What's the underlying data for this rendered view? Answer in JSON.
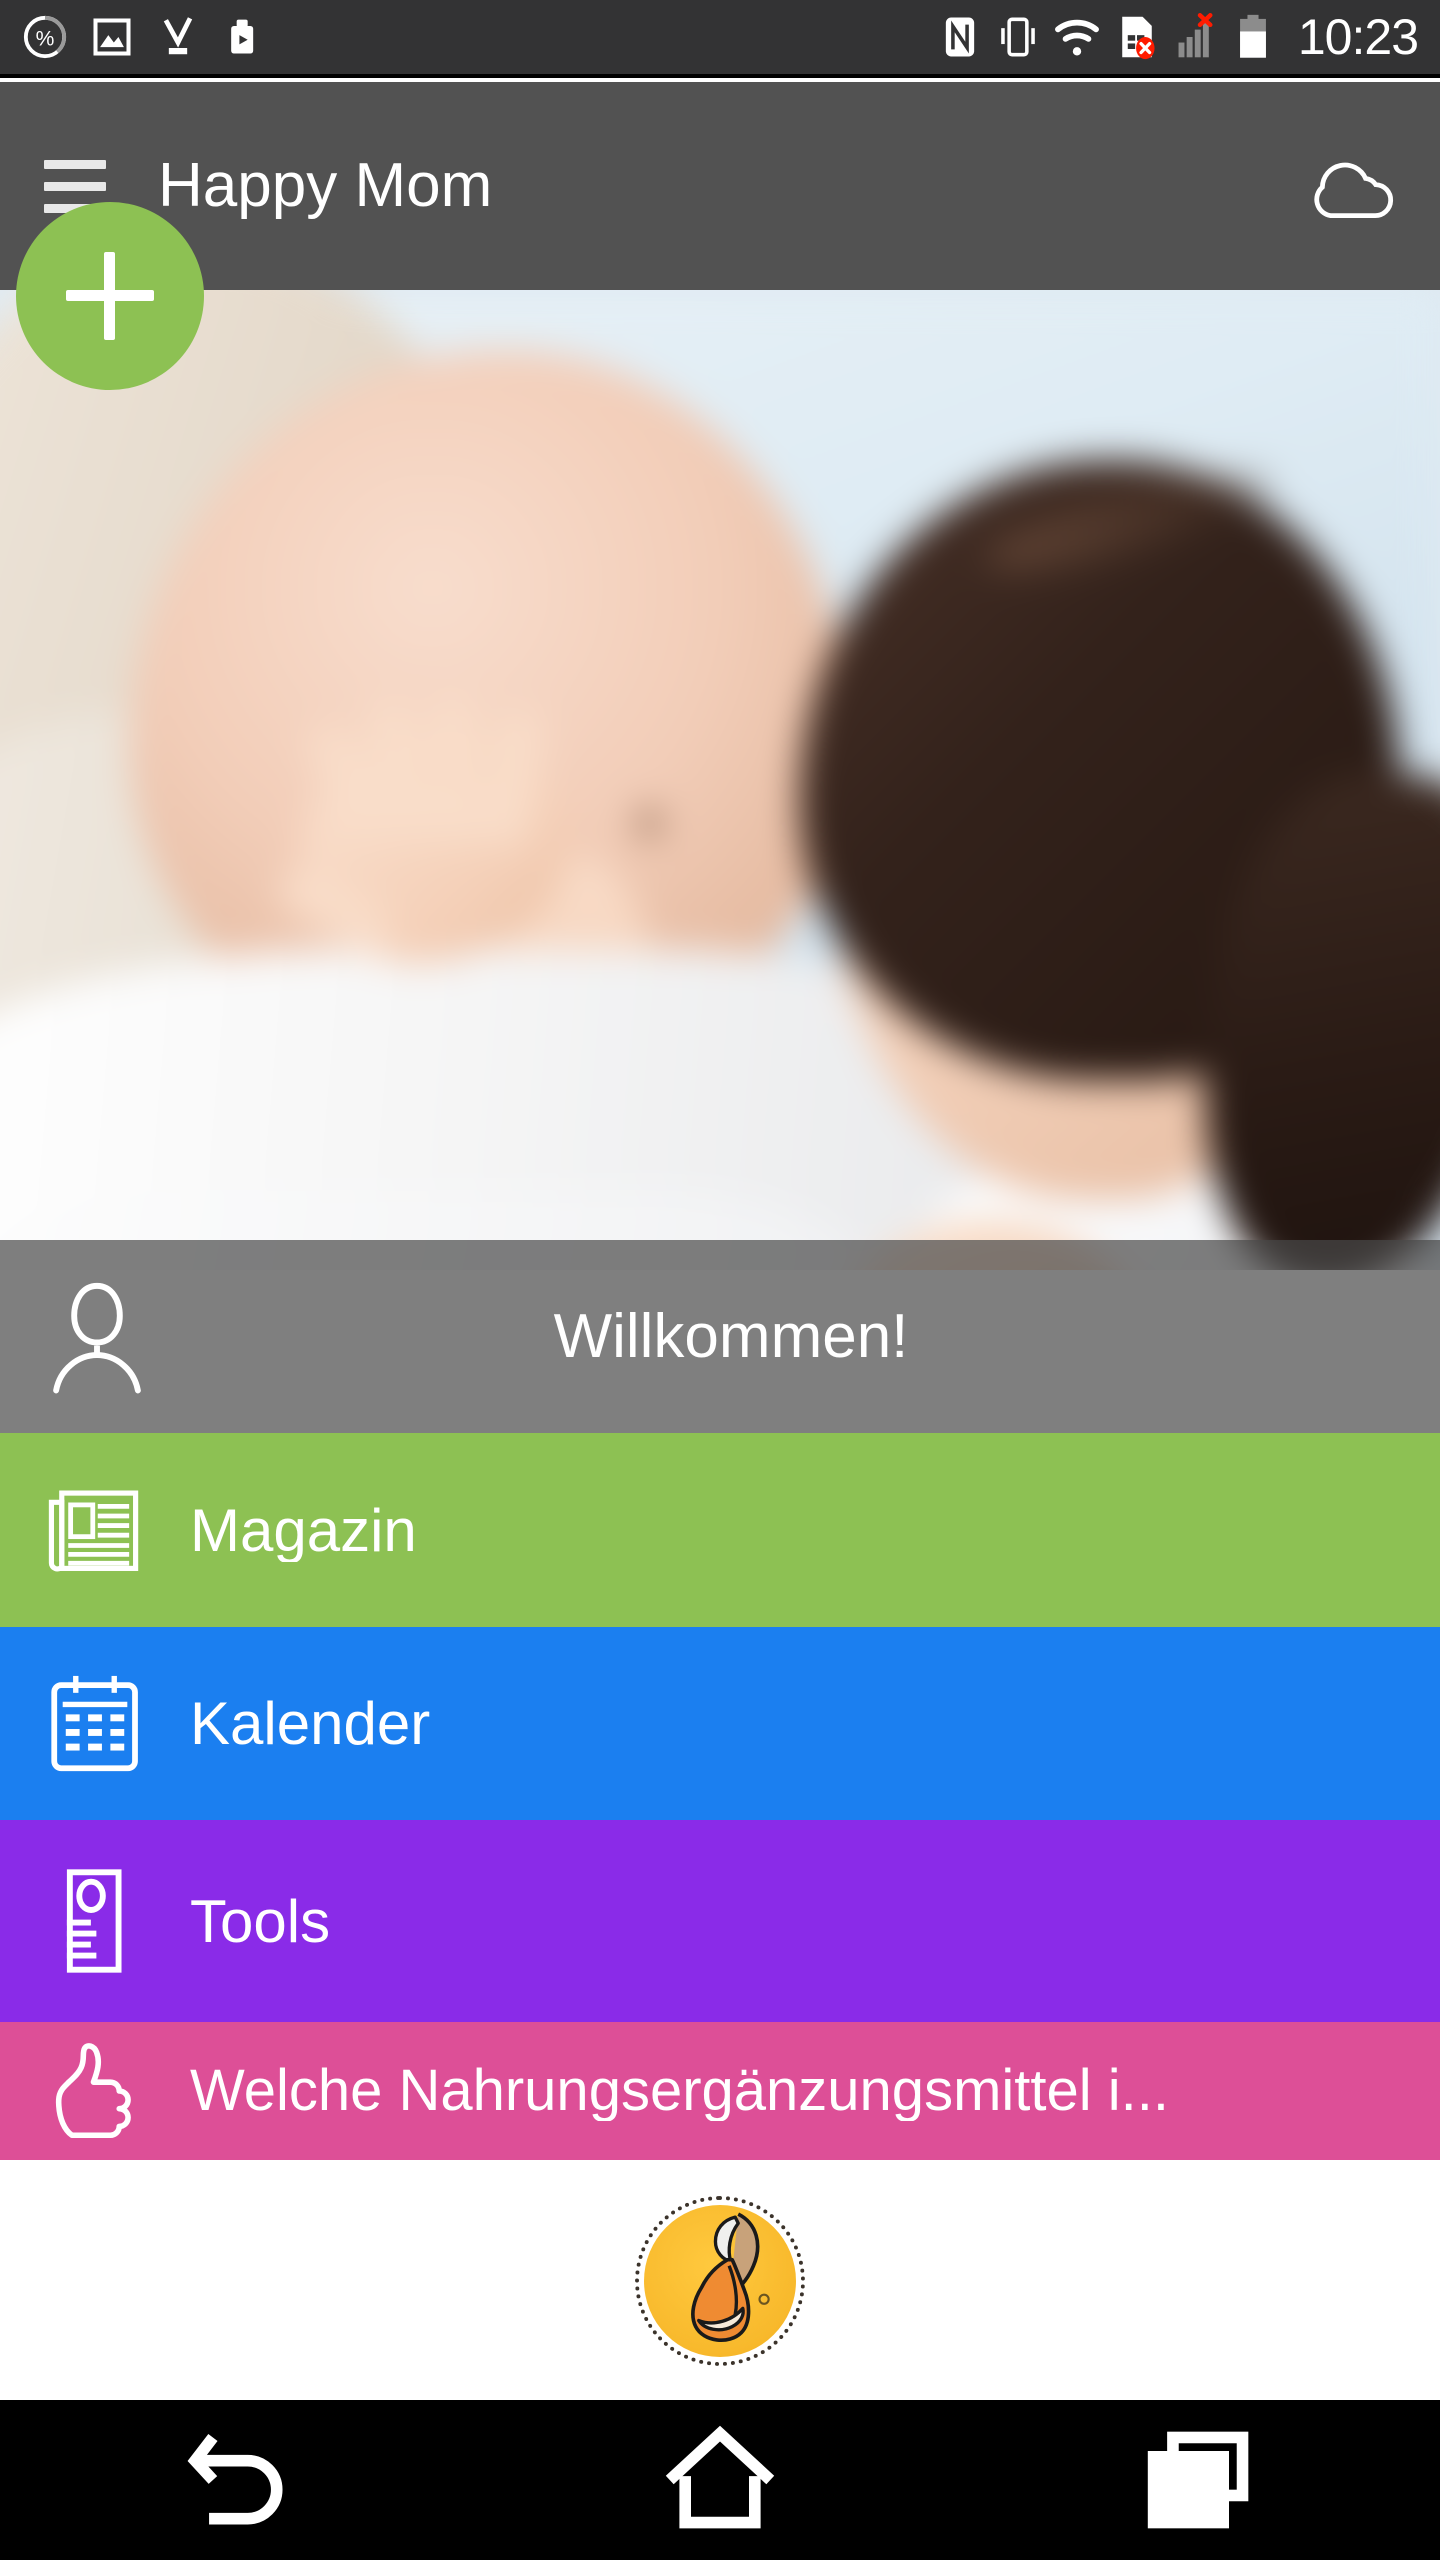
{
  "status_bar": {
    "time": "10:23",
    "left_icons": [
      {
        "name": "battery-percent-icon",
        "label": "%"
      },
      {
        "name": "gallery-image-icon",
        "label": "image"
      },
      {
        "name": "download-complete-icon",
        "label": "download"
      },
      {
        "name": "app-install-icon",
        "label": "app"
      }
    ],
    "right_icons": [
      {
        "name": "nfc-icon",
        "label": "NFC"
      },
      {
        "name": "vibrate-mode-icon",
        "label": "vibrate"
      },
      {
        "name": "wifi-icon",
        "label": "wifi"
      },
      {
        "name": "sim-card-error-icon",
        "label": "no SIM"
      },
      {
        "name": "signal-no-service-icon",
        "label": "no signal"
      },
      {
        "name": "battery-icon",
        "label": "battery"
      }
    ],
    "background_color": "#333334"
  },
  "app_bar": {
    "title": "Happy Mom",
    "menu_icon": "hamburger-menu-icon",
    "action_icon": "cloud-icon",
    "background_color": "#525252",
    "text_color": "#ffffff"
  },
  "hero": {
    "fab": {
      "icon": "plus-icon",
      "label": "+",
      "color": "#8DC153"
    },
    "alt": "pregnant-belly-with-toddler-photo"
  },
  "welcome": {
    "icon": "user-avatar-icon",
    "text": "Willkommen!",
    "overlay_color": "rgba(72,72,72,0.70)"
  },
  "menu": {
    "items": [
      {
        "label": "Magazin",
        "icon": "newspaper-icon",
        "color": "#8DC153",
        "name": "magazin"
      },
      {
        "label": "Kalender",
        "icon": "calendar-icon",
        "color": "#1B7FF0",
        "name": "kalender"
      },
      {
        "label": "Tools",
        "icon": "ruler-icon",
        "color": "#8A2BE8",
        "name": "tools"
      },
      {
        "label": "Welche Nahrungsergänzungsmittel i...",
        "icon": "thumbs-up-icon",
        "color": "#DD4F97",
        "name": "nahrungsergaenzungsmittel"
      }
    ]
  },
  "footer": {
    "logo": "pregnant-woman-circular-logo",
    "logo_bg": "#F8B92C"
  },
  "nav_bar": {
    "buttons": [
      {
        "label": "Back",
        "icon": "back-arrow-icon",
        "name": "back"
      },
      {
        "label": "Home",
        "icon": "home-icon",
        "name": "home"
      },
      {
        "label": "Recents",
        "icon": "recent-apps-icon",
        "name": "recents"
      }
    ],
    "background_color": "#000000"
  }
}
